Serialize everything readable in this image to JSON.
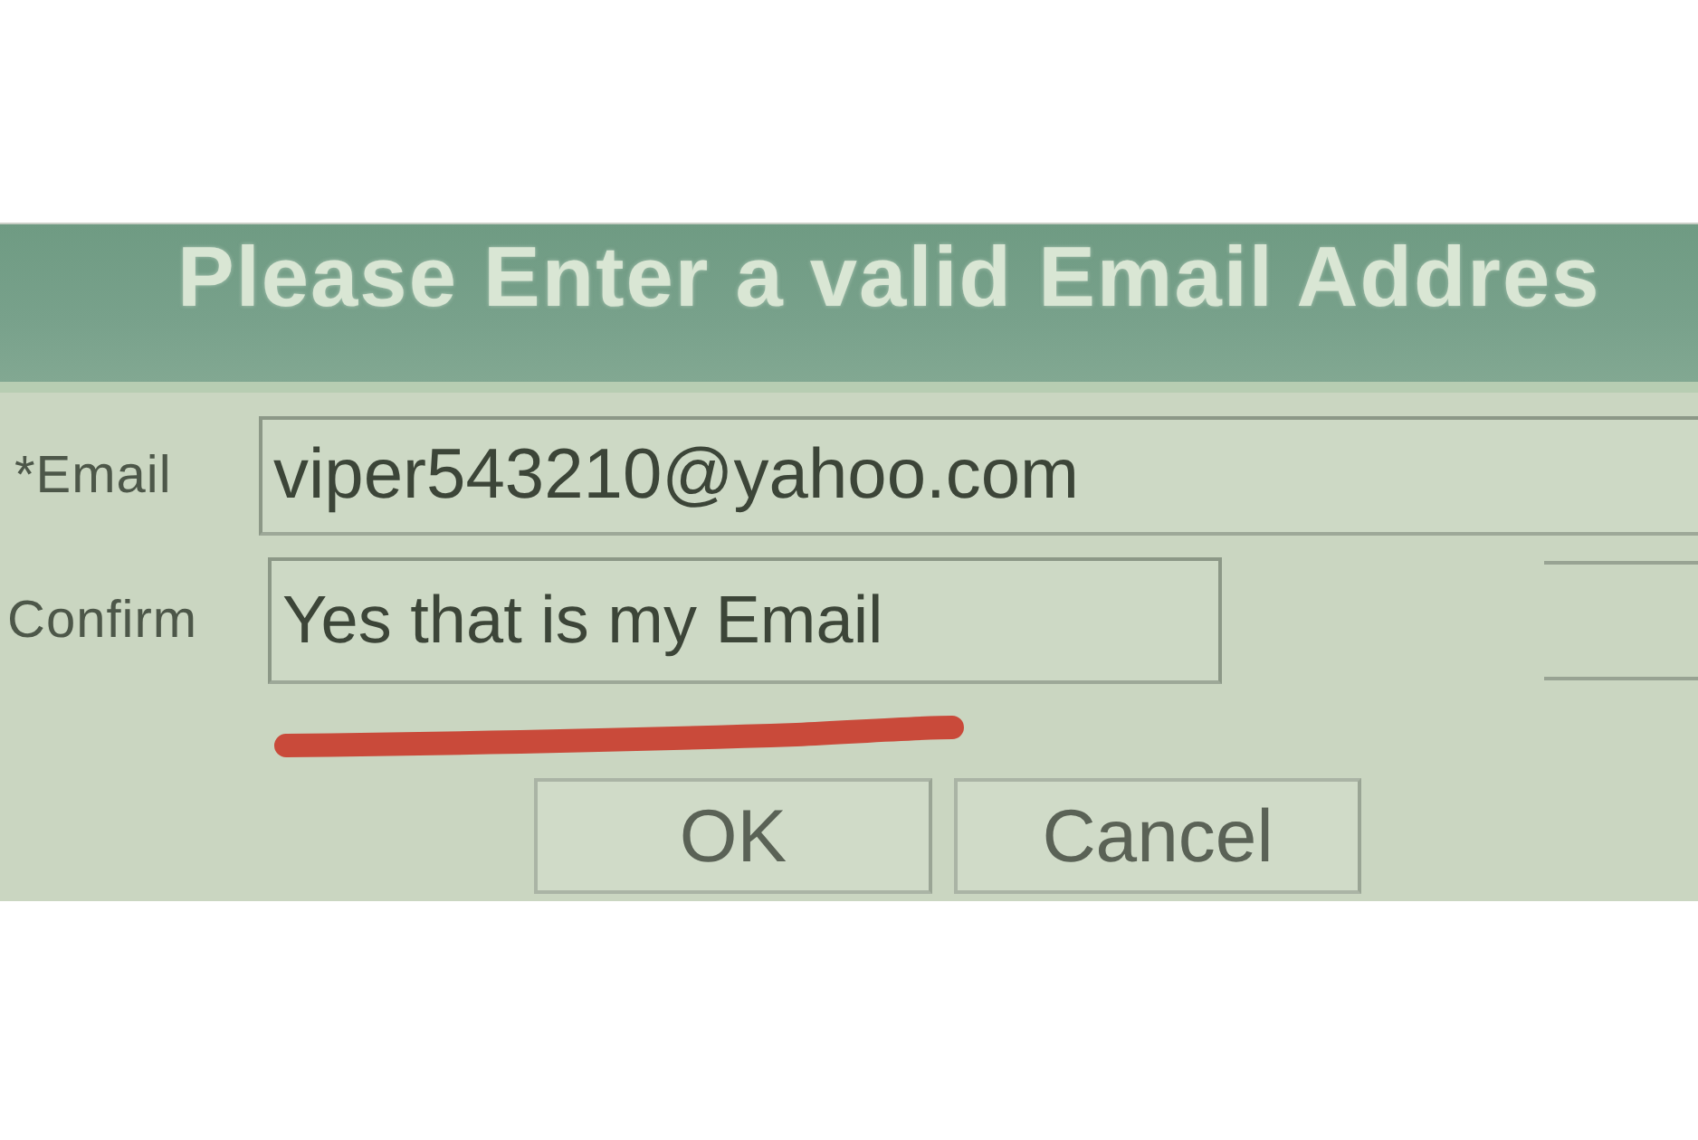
{
  "dialog": {
    "title": "Please Enter a valid Email Addres"
  },
  "fields": [
    {
      "label": "*Email",
      "value": "viper543210@yahoo.com"
    },
    {
      "label": "Confirm",
      "value": "Yes that is my Email",
      "underlined": true
    }
  ],
  "buttons": [
    "OK",
    "Cancel"
  ]
}
